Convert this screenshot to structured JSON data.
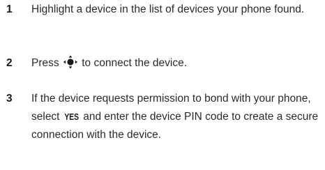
{
  "steps": [
    {
      "number": "1",
      "text": "Highlight a device in the list of devices your phone found."
    },
    {
      "number": "2",
      "text_before": "Press",
      "icon": "navigation-key-center-icon",
      "text_after": "to connect the device."
    },
    {
      "number": "3",
      "text_before": "If the device requests permission to bond with your phone, select",
      "key_label": "YES",
      "text_after": "and enter the device PIN code to create a secure connection with the device."
    }
  ]
}
